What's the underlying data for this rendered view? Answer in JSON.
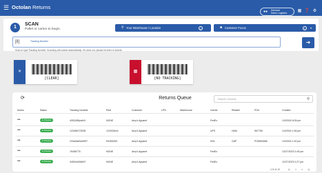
{
  "topbar": {
    "menu_icon": "hamburger-menu-icon",
    "brand": "Octolan",
    "product": "Returns",
    "org_line1": "Demand",
    "org_line2": "Demo Logistics",
    "icons": [
      "org-icon",
      "grid-icon",
      "help-icon",
      "settings-icon"
    ],
    "color": "#2a5ba8"
  },
  "scan": {
    "step_number": "1",
    "title": "SCAN",
    "subtitle": "Pallet or carton to begin.",
    "warehouse_label": "Your Warehouse / Location",
    "customer_label": "Customer Focus",
    "input_placeholder": "Tracking Number",
    "help_text": "Scan or type Tracking Number. Scanning will submit automatically. If it does not, please hit enter to submit."
  },
  "cards": [
    {
      "code": "[CLEAR]",
      "icon": "close-icon",
      "color": "#2a5ba8"
    },
    {
      "code": "[NO TRACKING]",
      "icon": "no-tracking-icon",
      "color": "#c8102e"
    }
  ],
  "queue": {
    "title": "Returns Queue",
    "search_placeholder": "Search Columns",
    "columns": [
      "Action",
      "Status",
      "Tracking Number",
      "RA#",
      "Customer",
      "LPN",
      "Warehouse",
      "Carrier",
      "Retailer",
      "PO#",
      "Created"
    ],
    "rows": [
      {
        "status": "In Process",
        "tracking": "4053455pc6v9",
        "ra": "NONE",
        "customer": "Amy's Apparel",
        "lpn": "",
        "warehouse": "",
        "carrier": "FedEx",
        "retailer": "",
        "po": "",
        "created": "1/9/2024 6:05 pm"
      },
      {
        "status": "In Process",
        "tracking": "123456723235",
        "ra": "123333444",
        "customer": "Amy's Apparel",
        "lpn": "",
        "warehouse": "",
        "carrier": "UPS",
        "retailer": "H&M",
        "po": "567755",
        "created": "1/4/2024 1:36 pm"
      },
      {
        "status": "In Process",
        "tracking": "234a3ae6ve9f97",
        "ra": "R4455263",
        "customer": "Amy's Apparel",
        "lpn": "",
        "warehouse": "",
        "carrier": "DHL",
        "retailer": "GAP",
        "po": "PO5654566",
        "created": "1/3/2024 1:20 pm"
      },
      {
        "status": "In Process",
        "tracking": "76456776",
        "ra": "NONE",
        "customer": "Amy's Apparel",
        "lpn": "",
        "warehouse": "",
        "carrier": "FedEx",
        "retailer": "",
        "po": "",
        "created": "12/27/2023 1:45 pm"
      },
      {
        "status": "In Process",
        "tracking": "345344456457",
        "ra": "NONE",
        "customer": "Amy's Apparel",
        "lpn": "",
        "warehouse": "",
        "carrier": "FedEx",
        "retailer": "",
        "po": "",
        "created": "12/27/2023 1:27 pm"
      }
    ],
    "pager_range": "1-5 of 12",
    "status_color": "#3cae52"
  }
}
